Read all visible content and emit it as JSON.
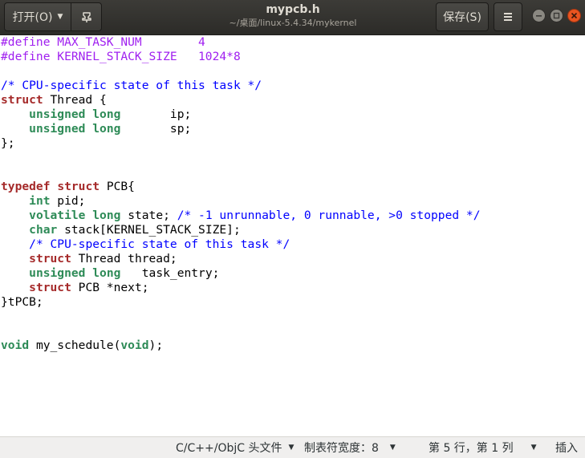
{
  "header": {
    "open_label": "打开(O)",
    "title": "mypcb.h",
    "path": "~/桌面/linux-5.4.34/mykernel",
    "save_label": "保存(S)"
  },
  "editor": {
    "lines": [
      [
        {
          "c": "pp",
          "t": "#define MAX_TASK_NUM        4"
        }
      ],
      [
        {
          "c": "pp",
          "t": "#define KERNEL_STACK_SIZE   1024*8"
        }
      ],
      [],
      [
        {
          "c": "cm",
          "t": "/* CPU-specific state of this task */"
        }
      ],
      [
        {
          "c": "kw",
          "t": "struct"
        },
        {
          "c": "",
          "t": " Thread {"
        }
      ],
      [
        {
          "c": "",
          "t": "    "
        },
        {
          "c": "ty",
          "t": "unsigned"
        },
        {
          "c": "",
          "t": " "
        },
        {
          "c": "ty",
          "t": "long"
        },
        {
          "c": "",
          "t": "       ip;"
        }
      ],
      [
        {
          "c": "",
          "t": "    "
        },
        {
          "c": "ty",
          "t": "unsigned"
        },
        {
          "c": "",
          "t": " "
        },
        {
          "c": "ty",
          "t": "long"
        },
        {
          "c": "",
          "t": "       sp;"
        }
      ],
      [
        {
          "c": "",
          "t": "};"
        }
      ],
      [],
      [],
      [
        {
          "c": "kw",
          "t": "typedef"
        },
        {
          "c": "",
          "t": " "
        },
        {
          "c": "kw",
          "t": "struct"
        },
        {
          "c": "",
          "t": " PCB{"
        }
      ],
      [
        {
          "c": "",
          "t": "    "
        },
        {
          "c": "ty",
          "t": "int"
        },
        {
          "c": "",
          "t": " pid;"
        }
      ],
      [
        {
          "c": "",
          "t": "    "
        },
        {
          "c": "ty",
          "t": "volatile"
        },
        {
          "c": "",
          "t": " "
        },
        {
          "c": "ty",
          "t": "long"
        },
        {
          "c": "",
          "t": " state; "
        },
        {
          "c": "cm",
          "t": "/* -1 unrunnable, 0 runnable, >0 stopped */"
        }
      ],
      [
        {
          "c": "",
          "t": "    "
        },
        {
          "c": "ty",
          "t": "char"
        },
        {
          "c": "",
          "t": " stack[KERNEL_STACK_SIZE];"
        }
      ],
      [
        {
          "c": "",
          "t": "    "
        },
        {
          "c": "cm",
          "t": "/* CPU-specific state of this task */"
        }
      ],
      [
        {
          "c": "",
          "t": "    "
        },
        {
          "c": "kw",
          "t": "struct"
        },
        {
          "c": "",
          "t": " Thread thread;"
        }
      ],
      [
        {
          "c": "",
          "t": "    "
        },
        {
          "c": "ty",
          "t": "unsigned"
        },
        {
          "c": "",
          "t": " "
        },
        {
          "c": "ty",
          "t": "long"
        },
        {
          "c": "",
          "t": "   task_entry;"
        }
      ],
      [
        {
          "c": "",
          "t": "    "
        },
        {
          "c": "kw",
          "t": "struct"
        },
        {
          "c": "",
          "t": " PCB *next;"
        }
      ],
      [
        {
          "c": "",
          "t": "}tPCB;"
        }
      ],
      [],
      [],
      [
        {
          "c": "ty",
          "t": "void"
        },
        {
          "c": "",
          "t": " my_schedule("
        },
        {
          "c": "ty",
          "t": "void"
        },
        {
          "c": "",
          "t": ");"
        }
      ]
    ]
  },
  "statusbar": {
    "language": "C/C++/ObjC 头文件",
    "tab_width": "制表符宽度：8",
    "position": "第 5 行，第 1 列",
    "insert_mode": "插入"
  },
  "colors": {
    "preprocessor": "#a020f0",
    "comment": "#0000ff",
    "keyword": "#a52a2a",
    "type": "#2e8b57",
    "close_button": "#e95420"
  },
  "icons": {
    "open_dropdown": "chevron-down-icon",
    "pin": "pin-document-icon",
    "menu": "hamburger-menu-icon",
    "minimize": "window-minimize-icon",
    "maximize": "window-maximize-icon",
    "close": "window-close-icon"
  }
}
